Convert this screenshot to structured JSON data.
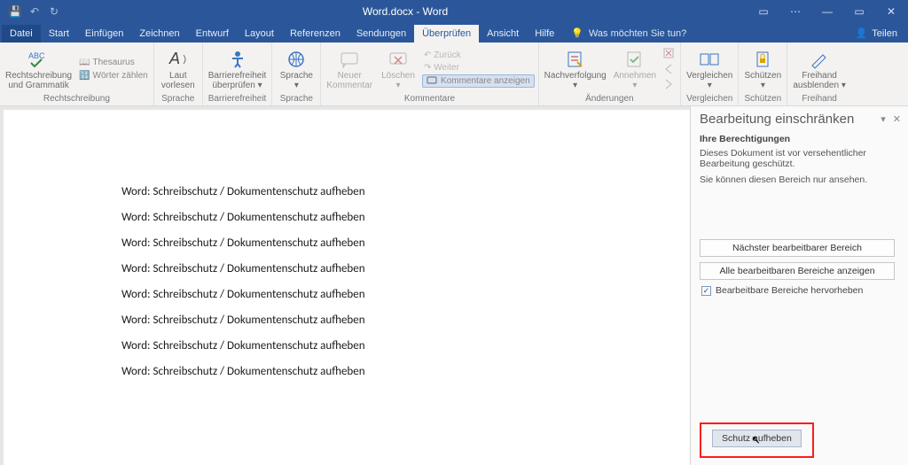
{
  "titlebar": {
    "title": "Word.docx - Word"
  },
  "qat": {
    "save": "💾",
    "undo": "↶",
    "redo": "↻"
  },
  "win": {
    "min": "—",
    "max": "▭",
    "close": "✕",
    "opts": "⋯",
    "ribbonOpts": "▭"
  },
  "tabs": {
    "file": "Datei",
    "items": [
      "Start",
      "Einfügen",
      "Zeichnen",
      "Entwurf",
      "Layout",
      "Referenzen",
      "Sendungen",
      "Überprüfen",
      "Ansicht",
      "Hilfe"
    ],
    "activeIndex": 7,
    "tell_icon": "💡",
    "tell": "Was möchten Sie tun?",
    "share_icon": "👤",
    "share": "Teilen"
  },
  "ribbon": {
    "g1_label": "Rechtschreibung",
    "g1_spell_l1": "Rechtschreibung",
    "g1_spell_l2": "und Grammatik",
    "g1_thes_icon": "📖",
    "g1_thes": "Thesaurus",
    "g1_count_icon": "🔢",
    "g1_count": "Wörter zählen",
    "g2_label": "Sprache",
    "g2_read_l1": "Laut",
    "g2_read_l2": "vorlesen",
    "g3_label": "Barrierefreiheit",
    "g3_l1": "Barrierefreiheit",
    "g3_l2": "überprüfen ▾",
    "g4_label": "Sprache",
    "g4_lang": "Sprache",
    "g4_drop": "▾",
    "g5_label": "Kommentare",
    "g5_new_l1": "Neuer",
    "g5_new_l2": "Kommentar",
    "g5_del": "Löschen",
    "g5_del_drop": "▾",
    "g5_back": "↶ Zurück",
    "g5_fwd": "↷ Weiter",
    "g5_show": "Kommentare anzeigen",
    "g6_label": "Änderungen",
    "g6_track": "Nachverfolgung",
    "g6_drop": "▾",
    "g6_accept": "Annehmen",
    "g6_accept_drop": "▾",
    "g7_label": "Vergleichen",
    "g7_cmp": "Vergleichen",
    "g7_drop": "▾",
    "g8_label": "Schützen",
    "g8_prot": "Schützen",
    "g8_drop": "▾",
    "g9_label": "Freihand",
    "g9_ink_l1": "Freihand",
    "g9_ink_l2": "ausblenden ▾"
  },
  "document": {
    "lines": [
      "Word: Schreibschutz / Dokumentenschutz aufheben",
      "Word: Schreibschutz / Dokumentenschutz aufheben",
      "Word: Schreibschutz / Dokumentenschutz aufheben",
      "Word: Schreibschutz / Dokumentenschutz aufheben",
      "Word: Schreibschutz / Dokumentenschutz aufheben",
      "Word: Schreibschutz / Dokumentenschutz aufheben",
      "Word: Schreibschutz / Dokumentenschutz aufheben",
      "Word: Schreibschutz / Dokumentenschutz aufheben"
    ]
  },
  "pane": {
    "title": "Bearbeitung einschränken",
    "menu": "▾",
    "close": "✕",
    "perm_h": "Ihre Berechtigungen",
    "perm_1": "Dieses Dokument ist vor versehentlicher Bearbeitung geschützt.",
    "perm_2": "Sie können diesen Bereich nur ansehen.",
    "btn_next": "Nächster bearbeitbarer Bereich",
    "btn_all": "Alle bearbeitbaren Bereiche anzeigen",
    "chk_label": "Bearbeitbare Bereiche hervorheben",
    "chk_mark": "✓",
    "btn_stop": "Schutz aufheben"
  }
}
